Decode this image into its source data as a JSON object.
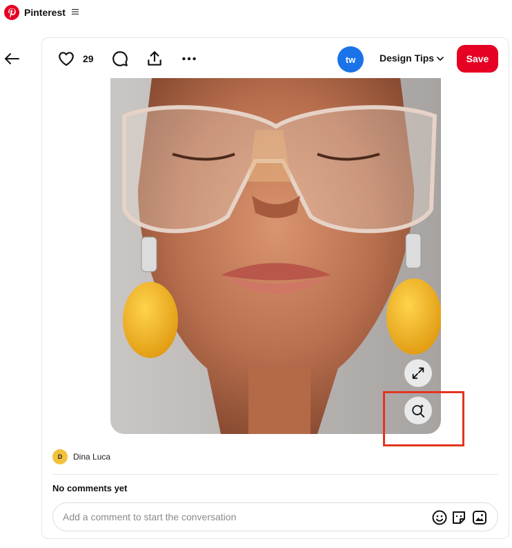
{
  "app": {
    "brand": "Pinterest"
  },
  "pin": {
    "likes": "29",
    "board_initials": "tw",
    "board_name": "Design Tips",
    "save_label": "Save",
    "author_initial": "D",
    "author_name": "Dina Luca",
    "comments_heading": "No comments yet",
    "comment_placeholder": "Add a comment to start the conversation"
  },
  "colors": {
    "brand_red": "#e60023",
    "highlight": "#e3341f",
    "board_blue": "#1a73e8",
    "author_yellow": "#f2c23c"
  },
  "icons": [
    "pinterest-logo",
    "menu-icon",
    "back-arrow-icon",
    "heart-icon",
    "comment-icon",
    "share-icon",
    "more-icon",
    "chevron-down-icon",
    "expand-icon",
    "visual-search-icon",
    "emoji-icon",
    "sticker-icon",
    "photo-icon"
  ]
}
